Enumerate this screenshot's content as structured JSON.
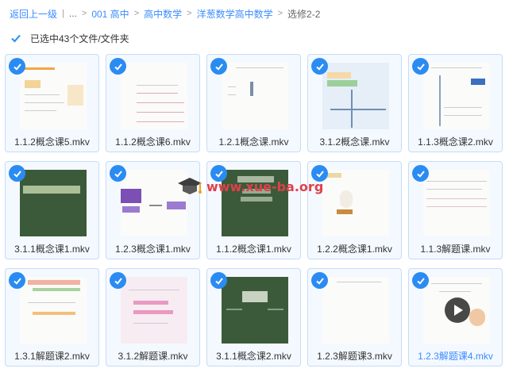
{
  "breadcrumb": {
    "back": "返回上一级",
    "ellipsis": "...",
    "items": [
      "001 高中",
      "高中数学",
      "洋葱数学高中数学"
    ],
    "current": "选修2-2"
  },
  "selection": {
    "text": "已选中43个文件/文件夹"
  },
  "watermark": {
    "text": "www.xue-ba.org"
  },
  "files": [
    {
      "name": "1.1.2概念课5.mkv",
      "thumb": "white"
    },
    {
      "name": "1.1.2概念课6.mkv",
      "thumb": "white"
    },
    {
      "name": "1.2.1概念课.mkv",
      "thumb": "white"
    },
    {
      "name": "3.1.2概念课.mkv",
      "thumb": "blue"
    },
    {
      "name": "1.1.3概念课2.mkv",
      "thumb": "white"
    },
    {
      "name": "3.1.1概念课1.mkv",
      "thumb": "green"
    },
    {
      "name": "1.2.3概念课1.mkv",
      "thumb": "white"
    },
    {
      "name": "1.1.2概念课1.mkv",
      "thumb": "green"
    },
    {
      "name": "1.2.2概念课1.mkv",
      "thumb": "white"
    },
    {
      "name": "1.1.3解题课.mkv",
      "thumb": "white"
    },
    {
      "name": "1.3.1解题课2.mkv",
      "thumb": "white"
    },
    {
      "name": "3.1.2解题课.mkv",
      "thumb": "white"
    },
    {
      "name": "3.1.1概念课2.mkv",
      "thumb": "green"
    },
    {
      "name": "1.2.3解题课3.mkv",
      "thumb": "white"
    },
    {
      "name": "1.2.3解题课4.mkv",
      "thumb": "white",
      "highlighted": true
    }
  ]
}
